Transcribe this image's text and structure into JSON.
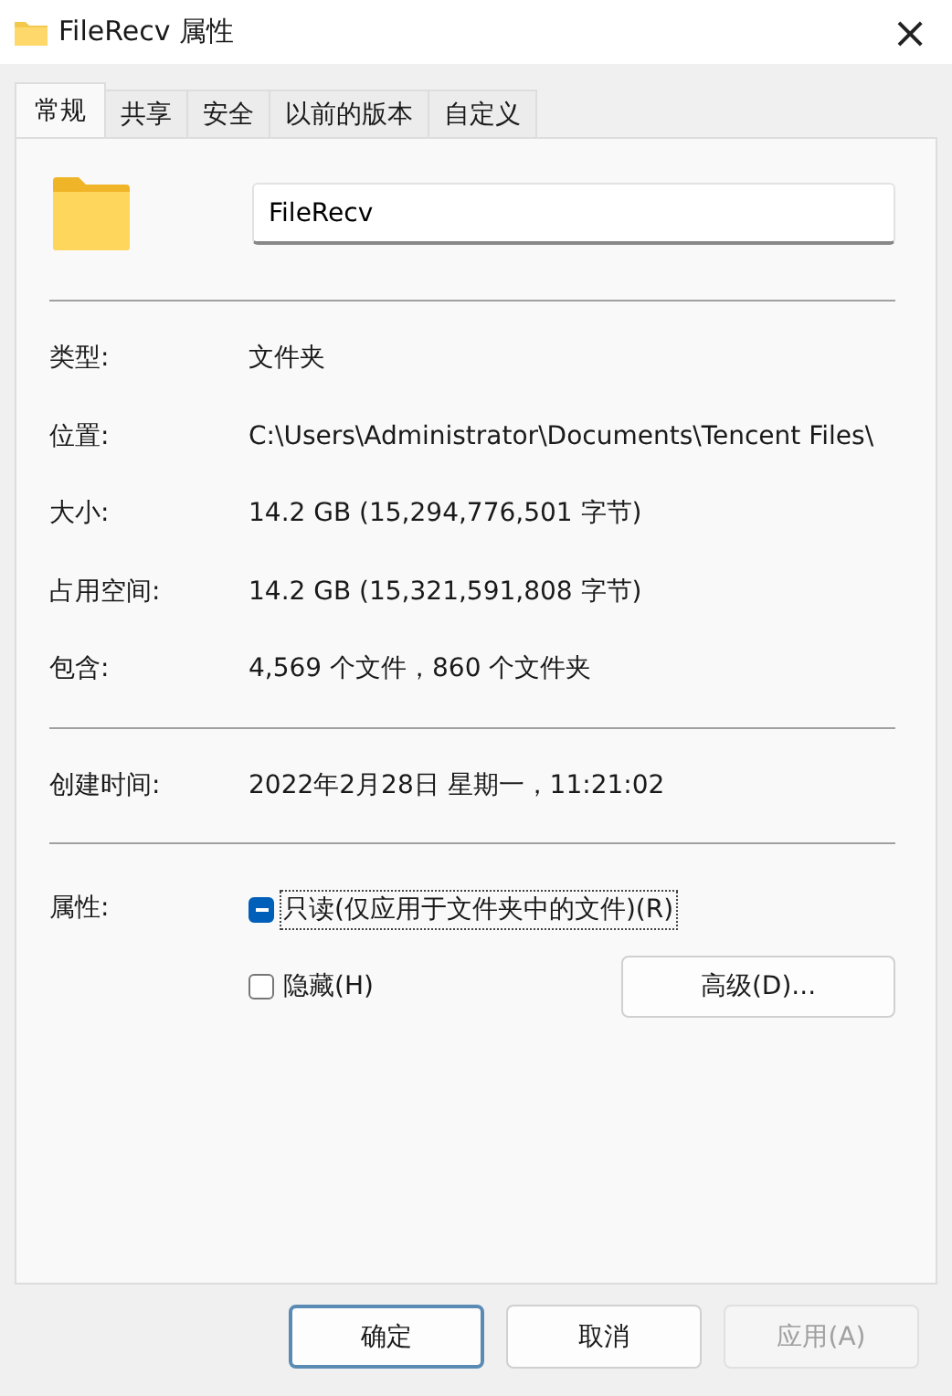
{
  "window": {
    "title": "FileRecv 属性",
    "close": "×"
  },
  "tabs": [
    {
      "label": "常规",
      "selected": true
    },
    {
      "label": "共享",
      "selected": false
    },
    {
      "label": "安全",
      "selected": false
    },
    {
      "label": "以前的版本",
      "selected": false
    },
    {
      "label": "自定义",
      "selected": false
    }
  ],
  "name_field": {
    "value": "FileRecv"
  },
  "groups": [
    [
      {
        "label": "类型:",
        "value": "文件夹"
      },
      {
        "label": "位置:",
        "value": "C:\\Users\\Administrator\\Documents\\Tencent Files\\"
      },
      {
        "label": "大小:",
        "value": "14.2 GB (15,294,776,501 字节)"
      },
      {
        "label": "占用空间:",
        "value": "14.2 GB (15,321,591,808 字节)"
      },
      {
        "label": "包含:",
        "value": "4,569 个文件，860 个文件夹"
      }
    ],
    [
      {
        "label": "创建时间:",
        "value": "2022年2月28日 星期一，11:21:02"
      }
    ]
  ],
  "attributes": {
    "label": "属性:",
    "checkboxes": [
      {
        "label": "只读(仅应用于文件夹中的文件)(R)",
        "indeterminate": true,
        "focused": true
      },
      {
        "label": "隐藏(H)",
        "checked": false,
        "indeterminate": false,
        "focused": false
      }
    ],
    "advanced_button": "高级(D)..."
  },
  "buttons": [
    {
      "label": "确定",
      "default": true,
      "disabled": false
    },
    {
      "label": "取消",
      "default": false,
      "disabled": false
    },
    {
      "label": "应用(A)",
      "default": false,
      "disabled": true
    }
  ]
}
